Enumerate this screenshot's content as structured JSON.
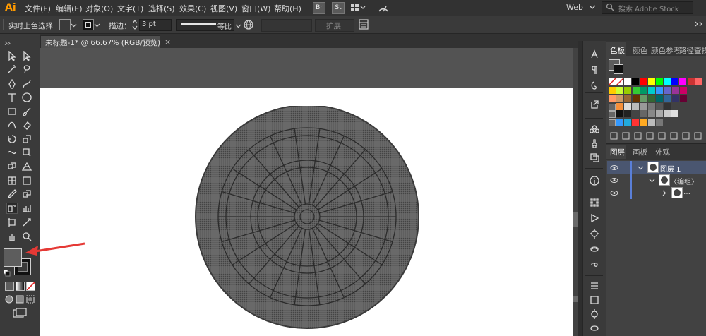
{
  "app": {
    "logo": "Ai"
  },
  "menu": [
    "文件(F)",
    "编辑(E)",
    "对象(O)",
    "文字(T)",
    "选择(S)",
    "效果(C)",
    "视图(V)",
    "窗口(W)",
    "帮助(H)"
  ],
  "app_buttons": [
    "Br",
    "St"
  ],
  "workspace": "Web",
  "search": {
    "placeholder": "搜索 Adobe Stock"
  },
  "control": {
    "selection_label": "实时上色选择",
    "stroke_label": "描边：",
    "stroke_value": "3 pt",
    "stroke_profile": "等比",
    "expand_label": "扩展"
  },
  "document": {
    "tab_title": "未标题-1* @ 66.67% (RGB/预览)",
    "close": "×"
  },
  "swatch_panel": {
    "tabs": [
      "色板",
      "颜色",
      "颜色参考",
      "路径查找"
    ]
  },
  "layers_panel": {
    "tabs": [
      "图层",
      "画板",
      "外观"
    ],
    "layer_name": "图层 1",
    "group_name": "〈编组〉",
    "path_name": "…"
  },
  "colors": {
    "menubar": "#323232",
    "panel": "#3a3a3a",
    "canvas": "#535353",
    "artboard": "#ffffff",
    "logo": "#ff9a00",
    "selection_accent": "#5a7fd8",
    "arrow": "#e53935",
    "circle_fill": "#5d5d5d",
    "circle_line": "#2b2b2b"
  },
  "swatch_rows": [
    [
      "#ffffff",
      "#000000",
      "#ff0000",
      "#ffff00",
      "#00ff00",
      "#00ffff",
      "#0000ff",
      "#ff00ff",
      "#cc3333",
      "#ff6666"
    ],
    [
      "#ffcc00",
      "#ccff33",
      "#99cc00",
      "#33cc33",
      "#009966",
      "#00cccc",
      "#3399ff",
      "#6666cc",
      "#993399",
      "#cc0066"
    ],
    [
      "#ff9966",
      "#cc9966",
      "#996633",
      "#663300",
      "#669966",
      "#336633",
      "#006666",
      "#336699",
      "#333366",
      "#660033"
    ],
    [
      "#f58f3a",
      "#dddddd",
      "#bbbbbb",
      "#999999",
      "#777777",
      "#555555",
      "#333333"
    ],
    [
      "#111111",
      "#222222",
      "#444444",
      "#666666",
      "#888888",
      "#aaaaaa",
      "#cccccc",
      "#e0e0e0"
    ],
    [
      "#3399ff",
      "#22aadd",
      "#ff3333",
      "#ffaa22",
      "#bbbbbb",
      "#777777"
    ]
  ]
}
